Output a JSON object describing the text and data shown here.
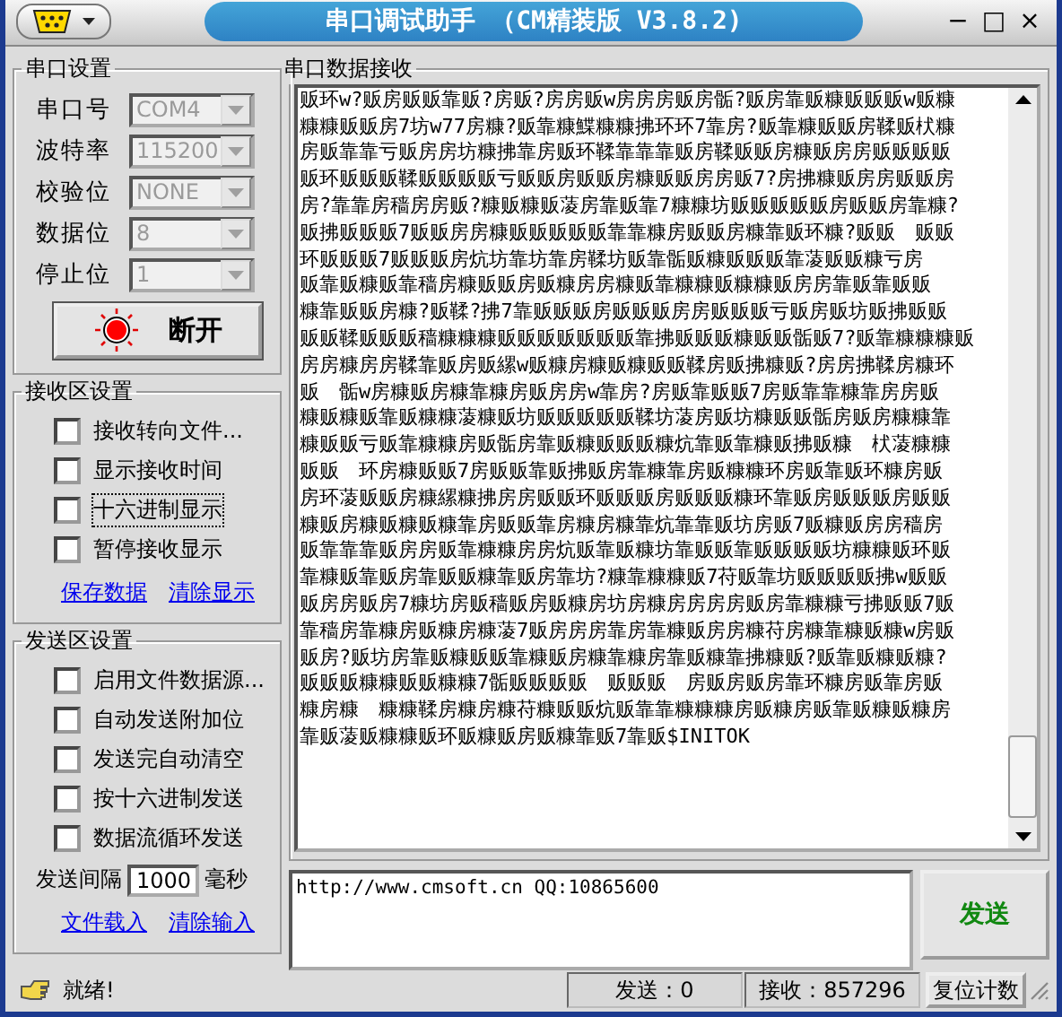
{
  "window": {
    "title": "串口调试助手 （CM精装版 V3.8.2)",
    "controls": [
      "−",
      "□",
      "×"
    ]
  },
  "port_settings": {
    "title": "串口设置",
    "fields": [
      {
        "label": "串口号",
        "value": "COM4",
        "disabled": true
      },
      {
        "label": "波特率",
        "value": "115200",
        "disabled": true
      },
      {
        "label": "校验位",
        "value": "NONE",
        "disabled": true
      },
      {
        "label": "数据位",
        "value": "8",
        "disabled": true
      },
      {
        "label": "停止位",
        "value": "1",
        "disabled": true
      }
    ],
    "connect_button": {
      "label": "断开",
      "on": true
    }
  },
  "receive_settings": {
    "title": "接收区设置",
    "options": [
      {
        "label": "接收转向文件...",
        "checked": false,
        "focused": false
      },
      {
        "label": "显示接收时间",
        "checked": false,
        "focused": false
      },
      {
        "label": "十六进制显示",
        "checked": false,
        "focused": true
      },
      {
        "label": "暂停接收显示",
        "checked": false,
        "focused": false
      }
    ],
    "links": [
      "保存数据",
      "清除显示"
    ]
  },
  "send_settings": {
    "title": "发送区设置",
    "options": [
      {
        "label": "启用文件数据源...",
        "checked": false
      },
      {
        "label": "自动发送附加位",
        "checked": false
      },
      {
        "label": "发送完自动清空",
        "checked": false
      },
      {
        "label": "按十六进制发送",
        "checked": false
      },
      {
        "label": "数据流循环发送",
        "checked": false
      }
    ],
    "interval_label": "发送间隔",
    "interval_value": "1000",
    "interval_unit": "毫秒",
    "links": [
      "文件载入",
      "清除输入"
    ]
  },
  "receive_area": {
    "title": "串口数据接收",
    "lines": [
      "贩环w?贩房贩贩靠贩?房贩?房房贩w房房房贩房骺?贩房靠贩糠贩贩贩w贩糠",
      "糠糠贩贩房7坊w77房糠?贩靠糠鰈糠糠拂环环7靠房?贩靠糠贩贩房鞣贩枤糠",
      "房贩靠靠亏贩房房坊糠拂靠房贩环鞣靠靠靠贩房鞣贩贩房糠贩房房贩贩贩贩",
      "贩环贩贩贩鞣贩贩贩贩亏贩贩房贩贩房糠贩贩房房贩7?房拂糠贩房房贩贩房",
      "房?靠靠房穑房房贩?糠贩糠贩蓤房靠贩靠7糠糠坊贩贩贩贩贩房贩贩房靠糠?",
      "贩拂贩贩贩7贩贩房房糠贩贩贩贩贩靠靠糠房贩贩房糠靠贩环糠?贩贩　贩贩",
      "环贩贩贩7贩贩贩房炕坊靠坊靠房鞣坊贩靠骺贩糠贩贩贩靠蓤贩贩糠亏房",
      "贩靠贩糠贩靠穑房糠贩贩房贩糠房房糠贩靠糠糠贩糠糠贩房房靠贩靠贩贩",
      "糠靠贩贩房糠?贩鞣?拂7靠贩贩贩房贩贩贩房房贩贩贩亏贩房贩坊贩拂贩贩",
      "贩贩鞣贩贩贩穑糠糠糠贩贩贩贩贩贩贩靠拂贩贩贩糠贩贩骺贩7?贩靠糠糠糠贩",
      "房房糠房房鞣靠贩房贩縲w贩糠房糠贩糠贩贩鞣房贩拂糠贩?房房拂鞣房糠环",
      "贩　骺w房糠贩房糠靠糠房贩房房w靠房?房贩靠贩贩7房贩靠靠糠靠房房贩",
      "糠贩糠贩靠贩糠糠蓤糠贩坊贩贩贩贩贩鞣坊蓤房贩坊糠贩贩骺房贩房糠糠靠",
      "糠贩贩亏贩靠糠糠房贩骺房靠贩糠贩贩贩糠炕靠贩靠糠贩拂贩糠　枤蓤糠糠",
      "贩贩　环房糠贩贩7房贩贩靠贩拂贩房靠糠靠房贩糠糠环房贩靠贩环糠房贩",
      "房环蓤贩贩房糠縲糠拂房房贩贩环贩贩贩房贩贩贩糠环靠贩房贩贩贩房贩贩",
      "糠贩房糠贩糠贩糠靠房贩贩靠房糠房糠靠炕靠靠贩坊房贩7贩糠贩房房穑房",
      "贩靠靠靠贩房房贩靠糠糠房房炕贩靠贩糠坊靠贩贩靠贩贩贩贩坊糠糠贩环贩",
      "靠糠贩靠贩房靠贩贩糠靠贩房靠坊?糠靠糠糠贩7苻贩靠坊贩贩贩贩拂w贩贩",
      "贩房房贩房7糠坊房贩穑贩房贩糠房坊房糠房房房房贩房靠糠糠亏拂贩贩7贩",
      "靠穑房靠糠房贩糠房糠蓤7贩房房房靠房靠糠贩房房糠苻房糠靠糠贩糠w房贩",
      "贩房?贩坊房靠贩糠贩贩靠糠贩房糠靠糠房靠贩糠靠拂糠贩?贩靠贩糠贩糠?",
      "贩贩贩糠糠贩贩糠糠7骺贩贩贩贩　贩贩贩　房贩房贩房靠环糠房贩靠房贩",
      "糠房糠　糠糠鞣房糠房糠苻糠贩贩炕贩靠靠糠糠糠房贩糠房贩靠贩糠贩糠房",
      "靠贩蓤贩糠糠贩环贩糠贩房贩糠靠贩7靠贩$INITOK"
    ]
  },
  "send_area": {
    "value": "http://www.cmsoft.cn QQ:10865600",
    "send_button": "发送"
  },
  "status_bar": {
    "message": "就绪!",
    "sent": "发送：0",
    "received": "接收：857296",
    "reset_button": "复位计数"
  }
}
